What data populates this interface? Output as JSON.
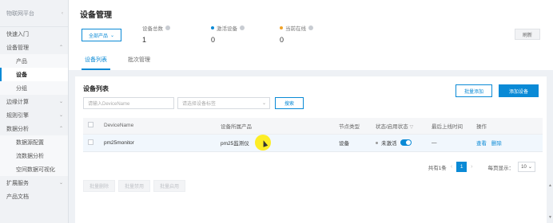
{
  "sidebar": {
    "logo": "物联网平台",
    "items": [
      {
        "label": "快速入门",
        "type": "top"
      },
      {
        "label": "设备管理",
        "type": "top",
        "expanded": true
      },
      {
        "label": "产品",
        "type": "sub"
      },
      {
        "label": "设备",
        "type": "sub",
        "active": true
      },
      {
        "label": "分组",
        "type": "sub"
      },
      {
        "label": "边缘计算",
        "type": "top"
      },
      {
        "label": "规则引擎",
        "type": "top"
      },
      {
        "label": "数据分析",
        "type": "top",
        "expanded": true
      },
      {
        "label": "数据源配置",
        "type": "sub"
      },
      {
        "label": "流数据分析",
        "type": "sub"
      },
      {
        "label": "空间数据可视化",
        "type": "sub"
      },
      {
        "label": "扩展服务",
        "type": "top"
      },
      {
        "label": "产品文档",
        "type": "top"
      }
    ]
  },
  "header": {
    "title": "设备管理",
    "product_select": "全部产品",
    "stats": [
      {
        "label": "设备总数",
        "value": "1",
        "dot_color": ""
      },
      {
        "label": "激活设备",
        "value": "0",
        "dot_color": "#0a8ad6"
      },
      {
        "label": "当前在线",
        "value": "0",
        "dot_color": "#f0a32a"
      }
    ],
    "refresh": "刷新",
    "tabs": [
      {
        "label": "设备列表",
        "active": true
      },
      {
        "label": "批次管理",
        "active": false
      }
    ]
  },
  "device_list": {
    "title": "设备列表",
    "batch_add": "批量添加",
    "add_device": "添加设备",
    "name_placeholder": "请输入DeviceName",
    "tag_placeholder": "请选择设备标签",
    "search": "搜索",
    "columns": [
      "DeviceName",
      "设备所属产品",
      "节点类型",
      "状态/启用状态",
      "最后上线时间",
      "操作"
    ],
    "rows": [
      {
        "device_name": "pm25monitor",
        "product": "pm25监测仪",
        "node_type": "设备",
        "status": "未激活",
        "enabled": true,
        "last_online": "—",
        "ops": [
          "查看",
          "删除"
        ]
      }
    ],
    "pagination": {
      "total": "共有1条",
      "current_page": "1",
      "page_size_label": "每页显示：",
      "page_size": "10"
    },
    "batch_buttons": [
      "批量删除",
      "批量禁用",
      "批量启用"
    ]
  },
  "colors": {
    "accent": "#0a8ad6"
  }
}
